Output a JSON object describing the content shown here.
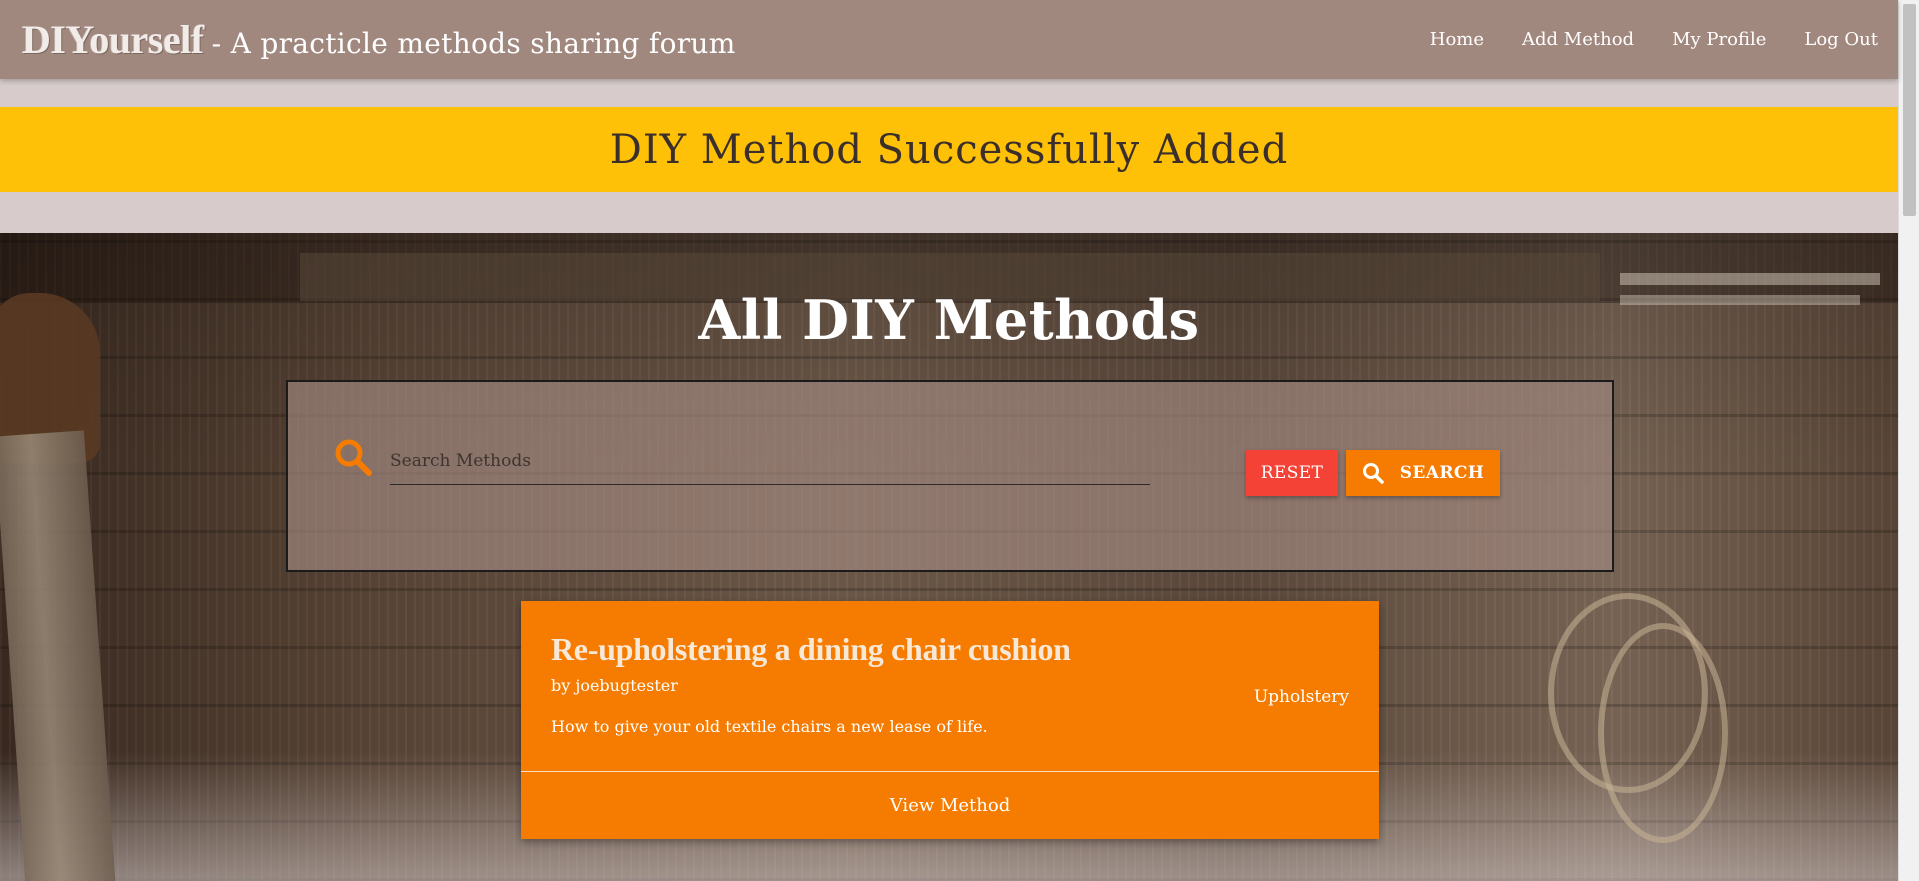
{
  "navbar": {
    "brand": "DIYourself",
    "tagline": "- A practicle methods sharing forum",
    "links": [
      "Home",
      "Add Method",
      "My Profile",
      "Log Out"
    ]
  },
  "flash": {
    "message": "DIY Method Successfully Added"
  },
  "hero": {
    "title": "All DIY Methods"
  },
  "search": {
    "placeholder": "Search Methods",
    "value": "",
    "reset_label": "RESET",
    "search_label": "SEARCH"
  },
  "methods": [
    {
      "title": "Re-upholstering a dining chair cushion",
      "author": "by joebugtester",
      "category": "Upholstery",
      "description": "How to give your old textile chairs a new lease of life.",
      "view_label": "View Method"
    }
  ],
  "colors": {
    "navbar": "#a1887f",
    "flash": "#ffc107",
    "page_bg": "#d7cccb",
    "accent": "#f57c00",
    "reset": "#f44336"
  }
}
